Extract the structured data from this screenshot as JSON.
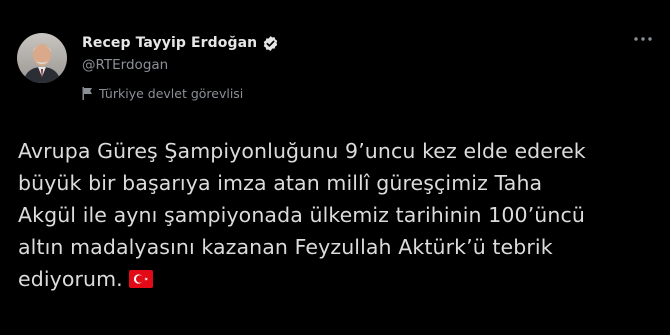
{
  "author": {
    "display_name": "Recep Tayyip Erdoğan",
    "handle": "@RTErdogan",
    "verified": true,
    "label": "Türkiye devlet görevlisi"
  },
  "tweet": {
    "lines": [
      "Avrupa Güreş Şampiyonluğunu 9’uncu kez elde ederek",
      "büyük bir başarıya imza atan millî güreşçimiz Taha",
      "Akgül ile aynı şampiyonada ülkemiz tarihinin 100’üncü",
      "altın madalyasını kazanan Feyzullah Aktürk’ü tebrik",
      "ediyorum."
    ],
    "trailing_emoji": "turkey-flag"
  },
  "icons": {
    "verified": "verified-badge-icon",
    "label_flag": "flag-icon",
    "more": "more-options-icon"
  },
  "colors": {
    "background": "#000000",
    "primary_text": "#dcdcdc",
    "secondary_text": "#8b9097",
    "flag_red": "#e30a17"
  }
}
